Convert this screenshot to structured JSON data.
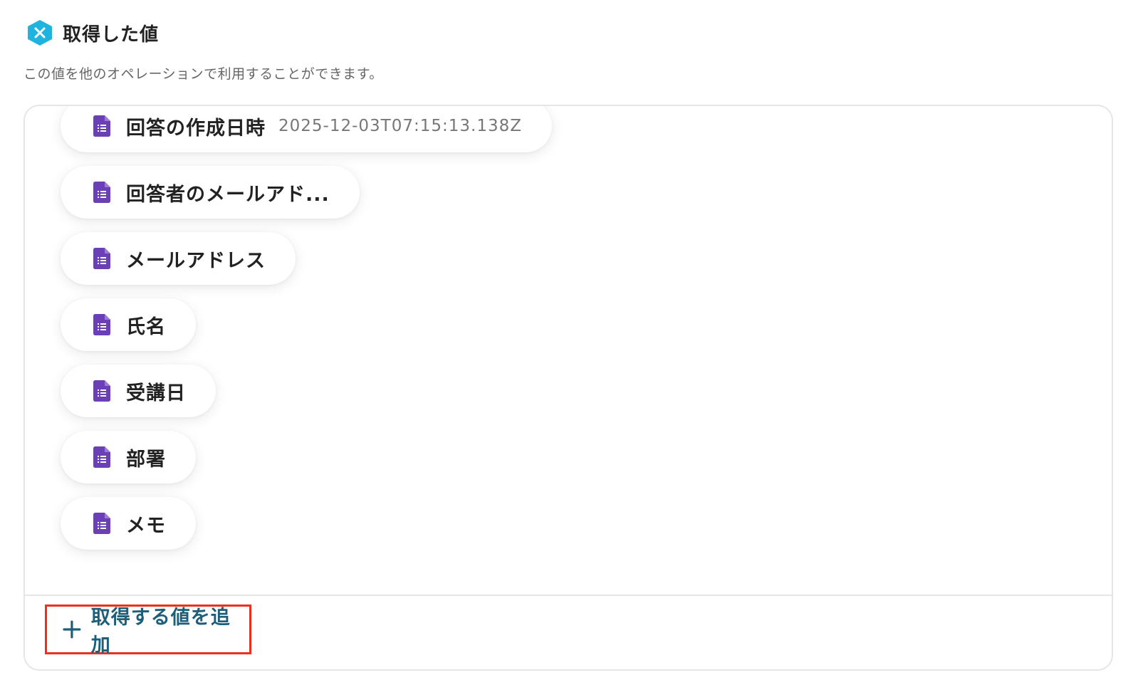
{
  "header": {
    "title": "取得した値",
    "subtitle": "この値を他のオペレーションで利用することができます。",
    "logo_icon": "yoom-x-logo-icon",
    "logo_color": "#1fb3e0"
  },
  "values": {
    "items": [
      {
        "label": "回答の作成日時",
        "value": "2025-12-03T07:15:13.138Z",
        "icon": "google-forms-icon"
      },
      {
        "label": "回答者のメールアド...",
        "icon": "google-forms-icon"
      },
      {
        "label": "メールアドレス",
        "icon": "google-forms-icon"
      },
      {
        "label": "氏名",
        "icon": "google-forms-icon"
      },
      {
        "label": "受講日",
        "icon": "google-forms-icon"
      },
      {
        "label": "部署",
        "icon": "google-forms-icon"
      },
      {
        "label": "メモ",
        "icon": "google-forms-icon"
      }
    ],
    "icon_color": "#6b3fb5"
  },
  "add_button": {
    "label": "取得する値を追加",
    "icon": "plus-icon",
    "text_color": "#1d5e79",
    "highlight_color": "#e8321e"
  }
}
